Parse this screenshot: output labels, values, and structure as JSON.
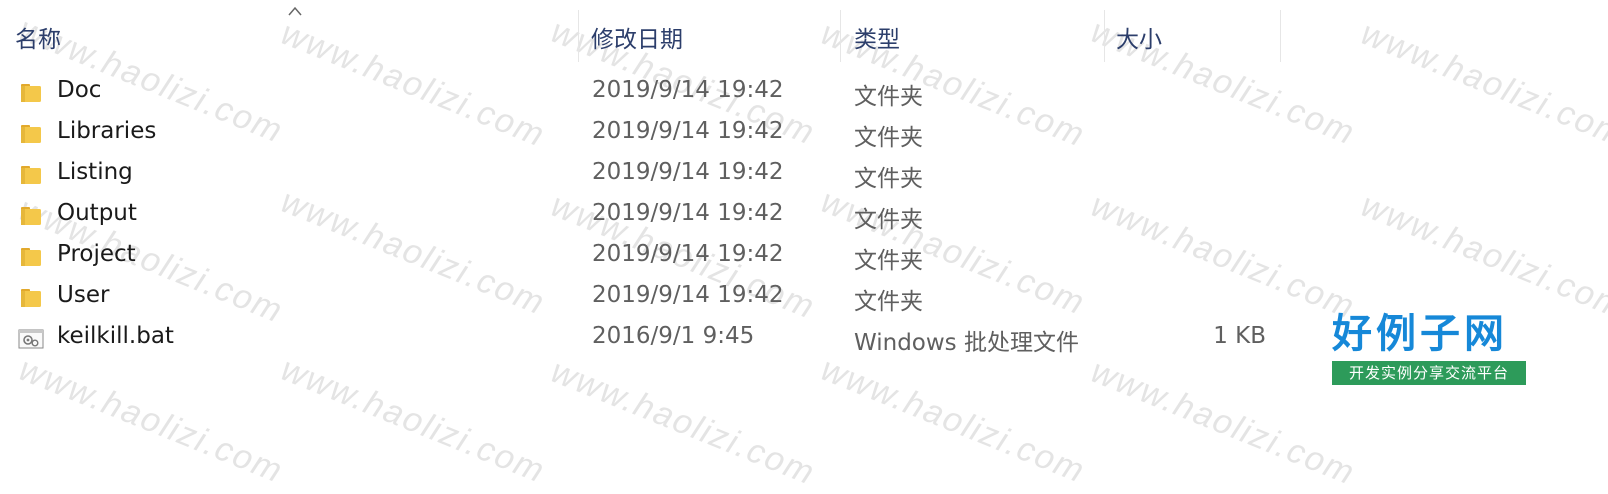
{
  "columns": {
    "name": "名称",
    "date": "修改日期",
    "type": "类型",
    "size": "大小"
  },
  "sort_indicator": "caret-up-icon",
  "rows": [
    {
      "icon": "folder-icon",
      "name": "Doc",
      "date": "2019/9/14 19:42",
      "type": "文件夹",
      "size": ""
    },
    {
      "icon": "folder-icon",
      "name": "Libraries",
      "date": "2019/9/14 19:42",
      "type": "文件夹",
      "size": ""
    },
    {
      "icon": "folder-icon",
      "name": "Listing",
      "date": "2019/9/14 19:42",
      "type": "文件夹",
      "size": ""
    },
    {
      "icon": "folder-icon",
      "name": "Output",
      "date": "2019/9/14 19:42",
      "type": "文件夹",
      "size": ""
    },
    {
      "icon": "folder-icon",
      "name": "Project",
      "date": "2019/9/14 19:42",
      "type": "文件夹",
      "size": ""
    },
    {
      "icon": "folder-icon",
      "name": "User",
      "date": "2019/9/14 19:42",
      "type": "文件夹",
      "size": ""
    },
    {
      "icon": "batch-file-icon",
      "name": "keilkill.bat",
      "date": "2016/9/1 9:45",
      "type": "Windows 批处理文件",
      "size": "1 KB"
    }
  ],
  "watermark": "www.haolizi.com",
  "logo": {
    "main": "好例子网",
    "sub": "开发实例分享交流平台"
  },
  "colors": {
    "header_text": "#2c3e6b",
    "folder_yellow": "#f4c84a",
    "logo_blue": "#1688d8",
    "logo_green": "#2d9b5a"
  }
}
